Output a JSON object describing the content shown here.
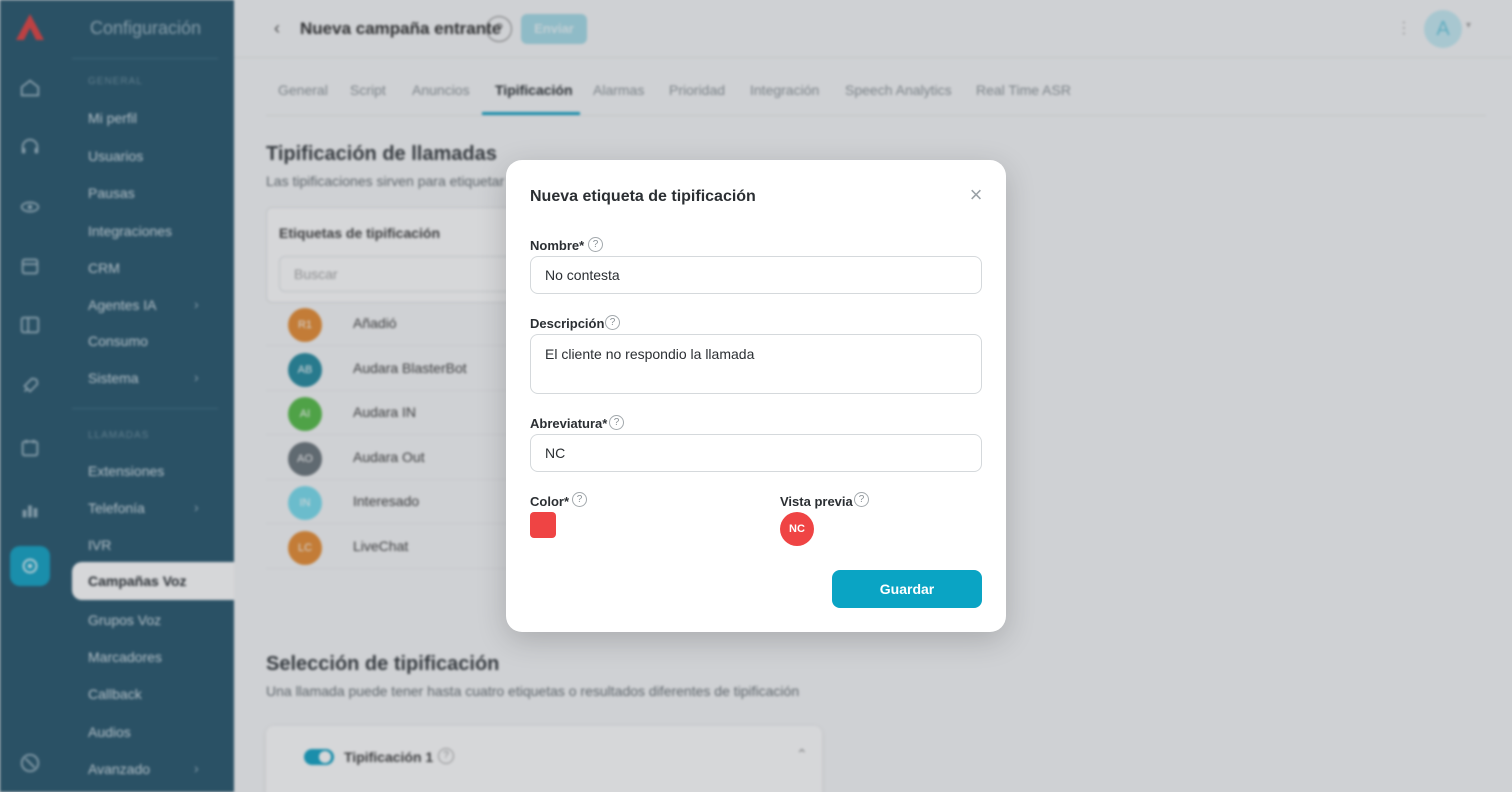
{
  "rail": {
    "icons": [
      "home-icon",
      "headset-icon",
      "eye-icon",
      "calendar-icon",
      "layout-icon",
      "rocket-icon",
      "calendar2-icon",
      "chart-icon",
      "settings-icon",
      "help-circle-icon"
    ]
  },
  "sidebar": {
    "title": "Configuración",
    "section_general": "General",
    "section_llamadas": "Llamadas",
    "items_general": [
      "Mi perfil",
      "Usuarios",
      "Pausas",
      "Integraciones",
      "CRM",
      "Agentes IA",
      "Consumo",
      "Sistema"
    ],
    "items_llamadas": [
      "Extensiones",
      "Telefonía",
      "IVR",
      "Campañas Voz",
      "Grupos Voz",
      "Marcadores",
      "Callback",
      "Audios",
      "Avanzado"
    ],
    "chevron": "›"
  },
  "header": {
    "back": "‹",
    "title": "Nueva campaña entrante",
    "help": "?",
    "publish": "Enviar",
    "avatar": "A",
    "dots": "⋮",
    "caret": "▾"
  },
  "tabs": [
    "General",
    "Script",
    "Anuncios",
    "Tipificación",
    "Alarmas",
    "Prioridad",
    "Integración",
    "Speech Analytics",
    "Real Time ASR"
  ],
  "section1": {
    "title": "Tipificación de llamadas",
    "subtitle": "Las tipificaciones sirven para etiquetar",
    "panel_label": "Etiquetas de tipificación",
    "search_placeholder": "Buscar"
  },
  "tags": [
    {
      "abbr": "R1",
      "label": "Añadió",
      "color": "#e8913a"
    },
    {
      "abbr": "AB",
      "label": "Audara BlasterBot",
      "color": "#2b8ea3"
    },
    {
      "abbr": "AI",
      "label": "Audara IN",
      "color": "#5bbf4e"
    },
    {
      "abbr": "AO",
      "label": "Audara Out",
      "color": "#707a80"
    },
    {
      "abbr": "IN",
      "label": "Interesado",
      "color": "#7ddff0"
    },
    {
      "abbr": "LC",
      "label": "LiveChat",
      "color": "#e8913a"
    }
  ],
  "section2": {
    "title": "Selección de tipificación",
    "subtitle": "Una llamada puede tener hasta cuatro etiquetas o resultados diferentes de tipificación",
    "card_label": "Tipificación 1",
    "caret": "⌃"
  },
  "modal": {
    "title": "Nueva etiqueta de tipificación",
    "close": "×",
    "name_label": "Nombre*",
    "name_value": "No contesta",
    "desc_label": "Descripción",
    "desc_value": "El cliente no respondio la llamada",
    "abbr_label": "Abreviatura*",
    "abbr_value": "NC",
    "color_label": "Color*",
    "color_value": "#ef4444",
    "preview_label": "Vista previa",
    "preview_text": "NC",
    "help": "?",
    "save": "Guardar"
  },
  "colors": {
    "accent": "#1aa6c7",
    "sidebar": "#2e5c72",
    "save_button": "#0aa4c4"
  }
}
